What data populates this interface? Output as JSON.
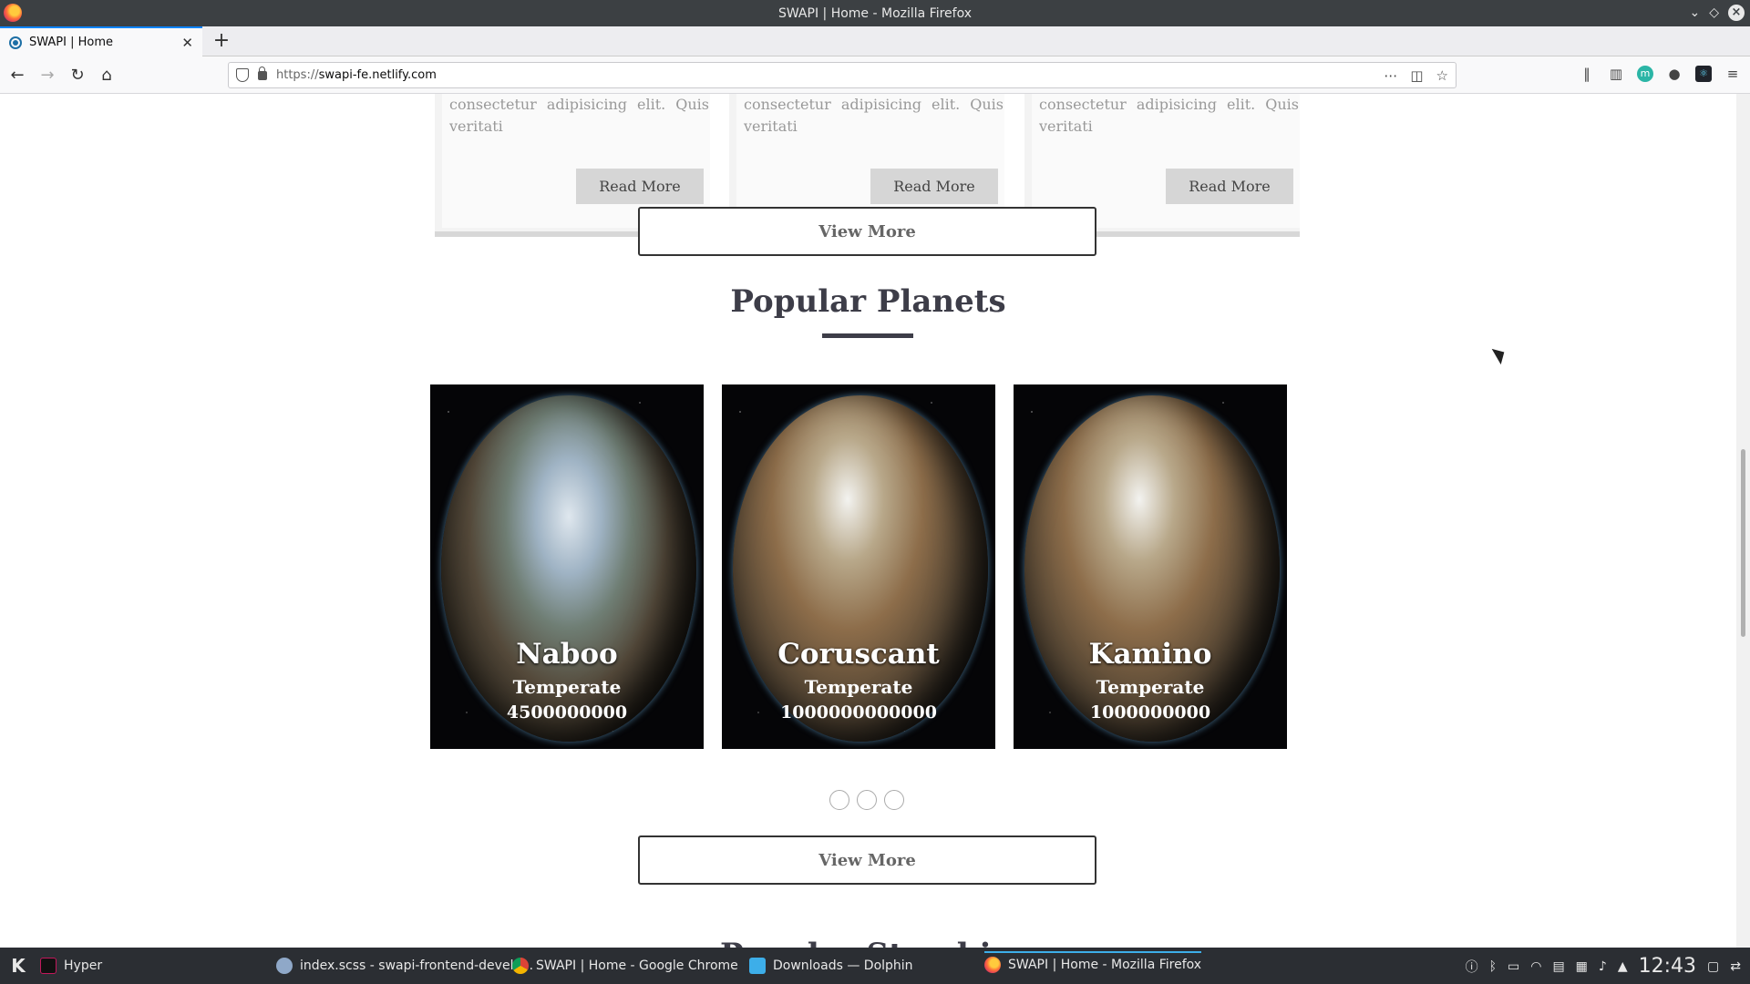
{
  "window": {
    "title": "SWAPI | Home - Mozilla Firefox"
  },
  "tabs": [
    {
      "label": "SWAPI | Home"
    }
  ],
  "urlbar": {
    "scheme": "https://",
    "host": "swapi-fe.netlify.com"
  },
  "posts": [
    {
      "excerpt": "consectetur adipisicing elit. Quis veritati",
      "button": "Read More"
    },
    {
      "excerpt": "consectetur adipisicing elit. Quis veritati",
      "button": "Read More"
    },
    {
      "excerpt": "consectetur adipisicing elit. Quis veritati",
      "button": "Read More"
    }
  ],
  "view_more_1": "View More",
  "planets_section": {
    "title": "Popular Planets",
    "planets": [
      {
        "name": "Naboo",
        "climate": "Temperate",
        "population": "4500000000"
      },
      {
        "name": "Coruscant",
        "climate": "Temperate",
        "population": "1000000000000"
      },
      {
        "name": "Kamino",
        "climate": "Temperate",
        "population": "1000000000"
      }
    ],
    "carousel_pages": 3
  },
  "view_more_2": "View More",
  "next_section_title": "Popular Starships",
  "taskbar": {
    "tasks": [
      {
        "label": "Hyper"
      },
      {
        "label": "index.scss - swapi-frontend-develo..."
      },
      {
        "label": "SWAPI | Home - Google Chrome"
      },
      {
        "label": "Downloads — Dolphin"
      },
      {
        "label": "SWAPI | Home - Mozilla Firefox"
      }
    ],
    "clock": "12:43"
  },
  "colors": {
    "accent": "#0a84ff",
    "heading": "#3d3d48",
    "taskbar": "#2b2e33"
  }
}
